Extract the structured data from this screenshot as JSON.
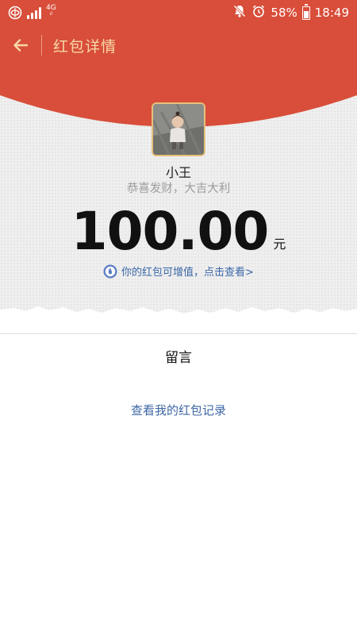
{
  "status_bar": {
    "network_type": "4G",
    "network_sub": "ıl",
    "battery_percent": "58%",
    "time": "18:49",
    "battery_level": 0.58
  },
  "app_bar": {
    "title": "红包详情",
    "back_icon": "arrow-left-icon"
  },
  "red_packet": {
    "sender_name": "小王",
    "blessing": "恭喜发财，大吉大利",
    "amount": "100.00",
    "currency": "元",
    "promo_text": "你的红包可增值，点击查看>"
  },
  "message_section": {
    "label": "留言"
  },
  "footer": {
    "record_link": "查看我的红包记录"
  },
  "colors": {
    "brand_red": "#d84e3a",
    "title_gold": "#f8d8a8",
    "link_blue": "#3f68a5",
    "avatar_border": "#e7c07b"
  }
}
